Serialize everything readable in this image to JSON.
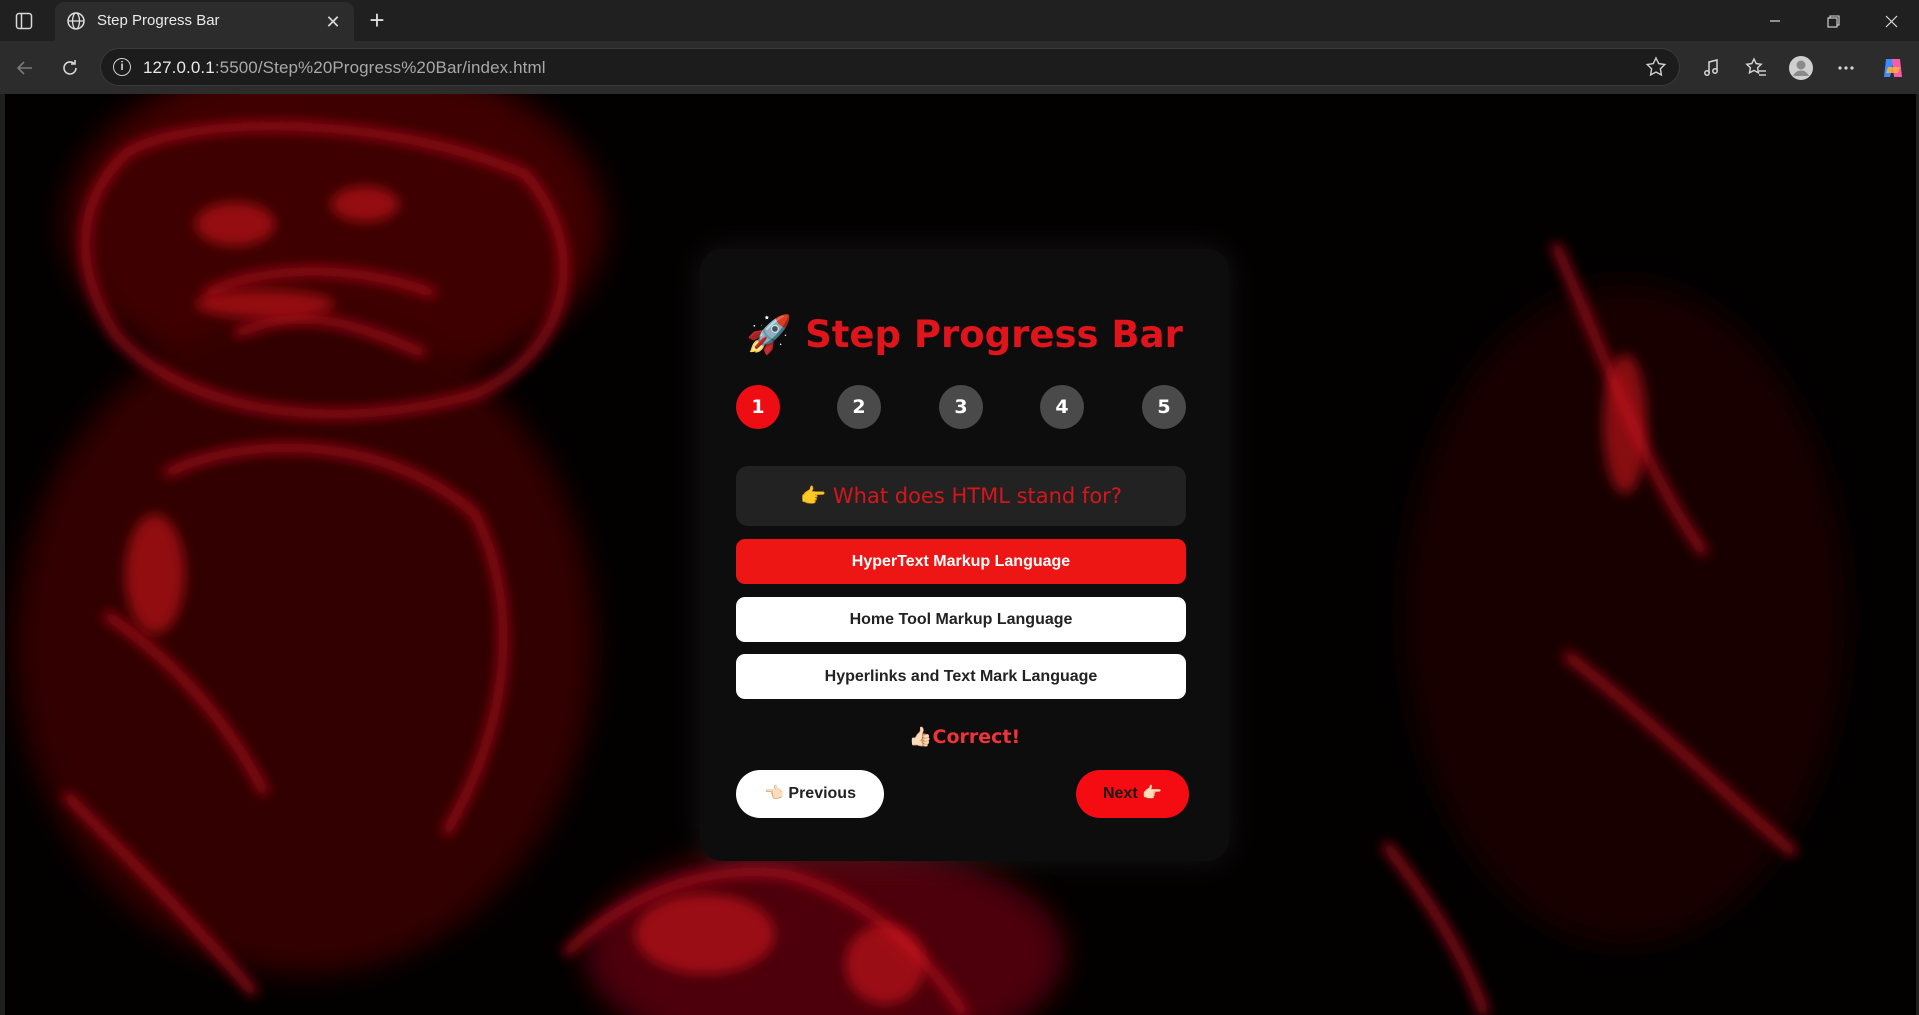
{
  "browser": {
    "tab_title": "Step Progress Bar",
    "url_host": "127.0.0.1",
    "url_rest": ":5500/Step%20Progress%20Bar/index.html",
    "new_tab_symbol": "+",
    "close_symbol": "✕"
  },
  "page": {
    "title": "Step Progress Bar",
    "title_icon": "🚀",
    "steps": [
      "1",
      "2",
      "3",
      "4",
      "5"
    ],
    "active_step": 1,
    "question_icon": "👉",
    "question": "What does HTML stand for?",
    "options": [
      "HyperText Markup Language",
      "Home Tool Markup Language",
      "Hyperlinks and Text Mark Language"
    ],
    "selected_option_index": 0,
    "feedback_icon": "👍🏻",
    "feedback": "Correct!",
    "prev_icon": "👈🏻",
    "prev_label": "Previous",
    "next_label": "Next",
    "next_icon": "👉🏻"
  },
  "colors": {
    "accent": "#ee0d13",
    "card_bg": "#0d0d0d",
    "question_bg": "#222222"
  }
}
